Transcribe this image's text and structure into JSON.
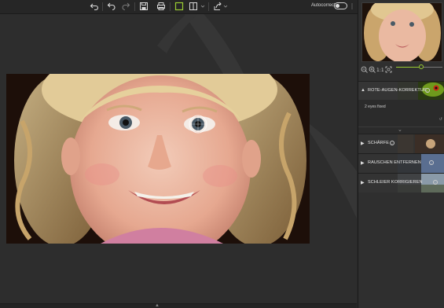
{
  "toolbar": {
    "autocorrect_label": "Autocorrect",
    "autocorrect_on": false,
    "icons": [
      "undo-icon",
      "undo-step-icon",
      "redo-icon",
      "save-icon",
      "print-icon",
      "crop-frame-icon",
      "compare-view-icon",
      "share-export-icon"
    ]
  },
  "panel": {
    "zoom_level": 0.55,
    "sections": [
      {
        "title": "ROTE-AUGEN-KORREKTUR",
        "expanded": true,
        "status": "2 eyes fixed"
      },
      {
        "title": "SCHÄRFE",
        "expanded": false
      },
      {
        "title": "RAUSCHEN ENTFERNEN",
        "expanded": false
      },
      {
        "title": "SCHLEIER KORRIGIEREN",
        "expanded": false
      }
    ]
  },
  "colors": {
    "accent": "#9acd32",
    "background": "#2b2b2b",
    "panel": "#2f2f2f"
  }
}
